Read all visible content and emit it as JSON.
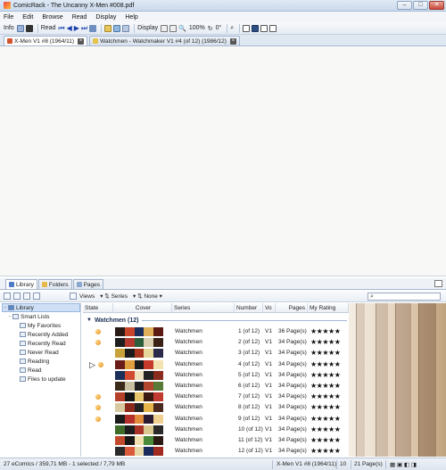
{
  "window": {
    "title": "ComicRack - The Uncanny X-Men #008.pdf",
    "controls": [
      "–",
      "□",
      "✕"
    ]
  },
  "menu": [
    "File",
    "Edit",
    "Browse",
    "Read",
    "Display",
    "Help"
  ],
  "toolbar": {
    "info_label": "Info",
    "read_label": "Read",
    "display_label": "Display",
    "zoom": "100%",
    "rotation": "0°"
  },
  "doc_tabs": [
    {
      "label": "X-Men V1 #8 (1964/11)",
      "active": true
    },
    {
      "label": "Watchmen - Watchmaker V1 #4 (of 12) (1986/12)",
      "active": false
    }
  ],
  "library_tabs": [
    "Library",
    "Folders",
    "Pages"
  ],
  "library_toolbar": {
    "views_label": "Views",
    "series_label": "Series",
    "none_label": "None"
  },
  "tree": {
    "root": "Library",
    "smart_lists": "Smart Lists",
    "items": [
      "My Favorites",
      "Recently Added",
      "Recently Read",
      "Never Read",
      "Reading",
      "Read",
      "Files to update"
    ]
  },
  "table": {
    "headers": {
      "state": "State",
      "cover": "Cover",
      "series": "Series",
      "number": "Number",
      "volume": "Vo",
      "pages": "Pages",
      "rating": "My Rating"
    },
    "group": "Watchmen (12)",
    "rows": [
      {
        "series": "Watchmen",
        "number": "1 (of 12)",
        "volume": "V1",
        "pages": "36 Page(s)",
        "rating": "★★★★★",
        "state": true,
        "current": false
      },
      {
        "series": "Watchmen",
        "number": "2 (of 12)",
        "volume": "V1",
        "pages": "34 Page(s)",
        "rating": "★★★★★",
        "state": true,
        "current": false
      },
      {
        "series": "Watchmen",
        "number": "3 (of 12)",
        "volume": "V1",
        "pages": "34 Page(s)",
        "rating": "★★★★★",
        "state": false,
        "current": false
      },
      {
        "series": "Watchmen",
        "number": "4 (of 12)",
        "volume": "V1",
        "pages": "34 Page(s)",
        "rating": "★★★★★",
        "state": true,
        "current": true
      },
      {
        "series": "Watchmen",
        "number": "5 (of 12)",
        "volume": "V1",
        "pages": "34 Page(s)",
        "rating": "★★★★★",
        "state": false,
        "current": false
      },
      {
        "series": "Watchmen",
        "number": "6 (of 12)",
        "volume": "V1",
        "pages": "34 Page(s)",
        "rating": "★★★★★",
        "state": false,
        "current": false
      },
      {
        "series": "Watchmen",
        "number": "7 (of 12)",
        "volume": "V1",
        "pages": "34 Page(s)",
        "rating": "★★★★★",
        "state": true,
        "current": false
      },
      {
        "series": "Watchmen",
        "number": "8 (of 12)",
        "volume": "V1",
        "pages": "34 Page(s)",
        "rating": "★★★★★",
        "state": true,
        "current": false
      },
      {
        "series": "Watchmen",
        "number": "9 (of 12)",
        "volume": "V1",
        "pages": "34 Page(s)",
        "rating": "★★★★★",
        "state": true,
        "current": false
      },
      {
        "series": "Watchmen",
        "number": "10 (of 12)",
        "volume": "V1",
        "pages": "34 Page(s)",
        "rating": "★★★★★",
        "state": false,
        "current": false
      },
      {
        "series": "Watchmen",
        "number": "11 (of 12)",
        "volume": "V1",
        "pages": "34 Page(s)",
        "rating": "★★★★★",
        "state": false,
        "current": false
      },
      {
        "series": "Watchmen",
        "number": "12 (of 12)",
        "volume": "V1",
        "pages": "34 Page(s)",
        "rating": "★★★★★",
        "state": false,
        "current": false
      }
    ]
  },
  "status": {
    "summary": "27 eComics / 359,71 MB - 1 selected / 7,79 MB",
    "current_book": "X-Men V1 #8 (1964/11)",
    "page": "10",
    "page_count": "21 Page(s)"
  },
  "colors": {
    "accent": "#1b3fae",
    "selection": "#cfe0f6",
    "state_dot": "#e08a12"
  }
}
